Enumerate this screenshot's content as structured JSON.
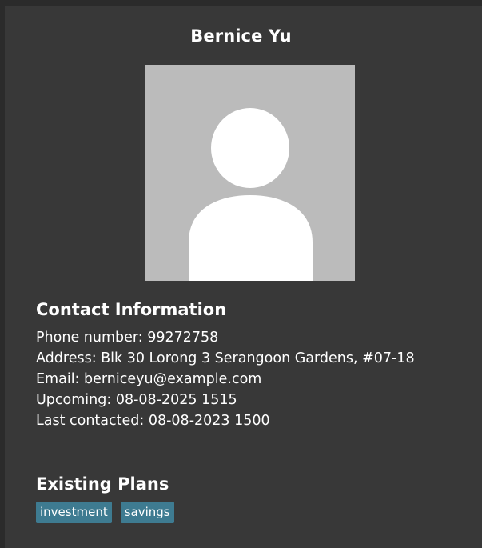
{
  "person": {
    "name": "Bernice Yu",
    "avatar_icon": "person-silhouette-icon"
  },
  "contact": {
    "title": "Contact Information",
    "phone": "Phone number: 99272758",
    "address": "Address: Blk 30 Lorong 3 Serangoon Gardens, #07-18",
    "email": "Email: berniceyu@example.com",
    "upcoming": "Upcoming: 08-08-2025 1515",
    "last_contacted": "Last contacted: 08-08-2023 1500"
  },
  "plans": {
    "title": "Existing Plans",
    "tags": [
      "investment",
      "savings"
    ]
  },
  "colors": {
    "background": "#383838",
    "tag": "#3e7b91",
    "avatar_bg": "#bbbbbb",
    "avatar_fg": "#ffffff"
  }
}
